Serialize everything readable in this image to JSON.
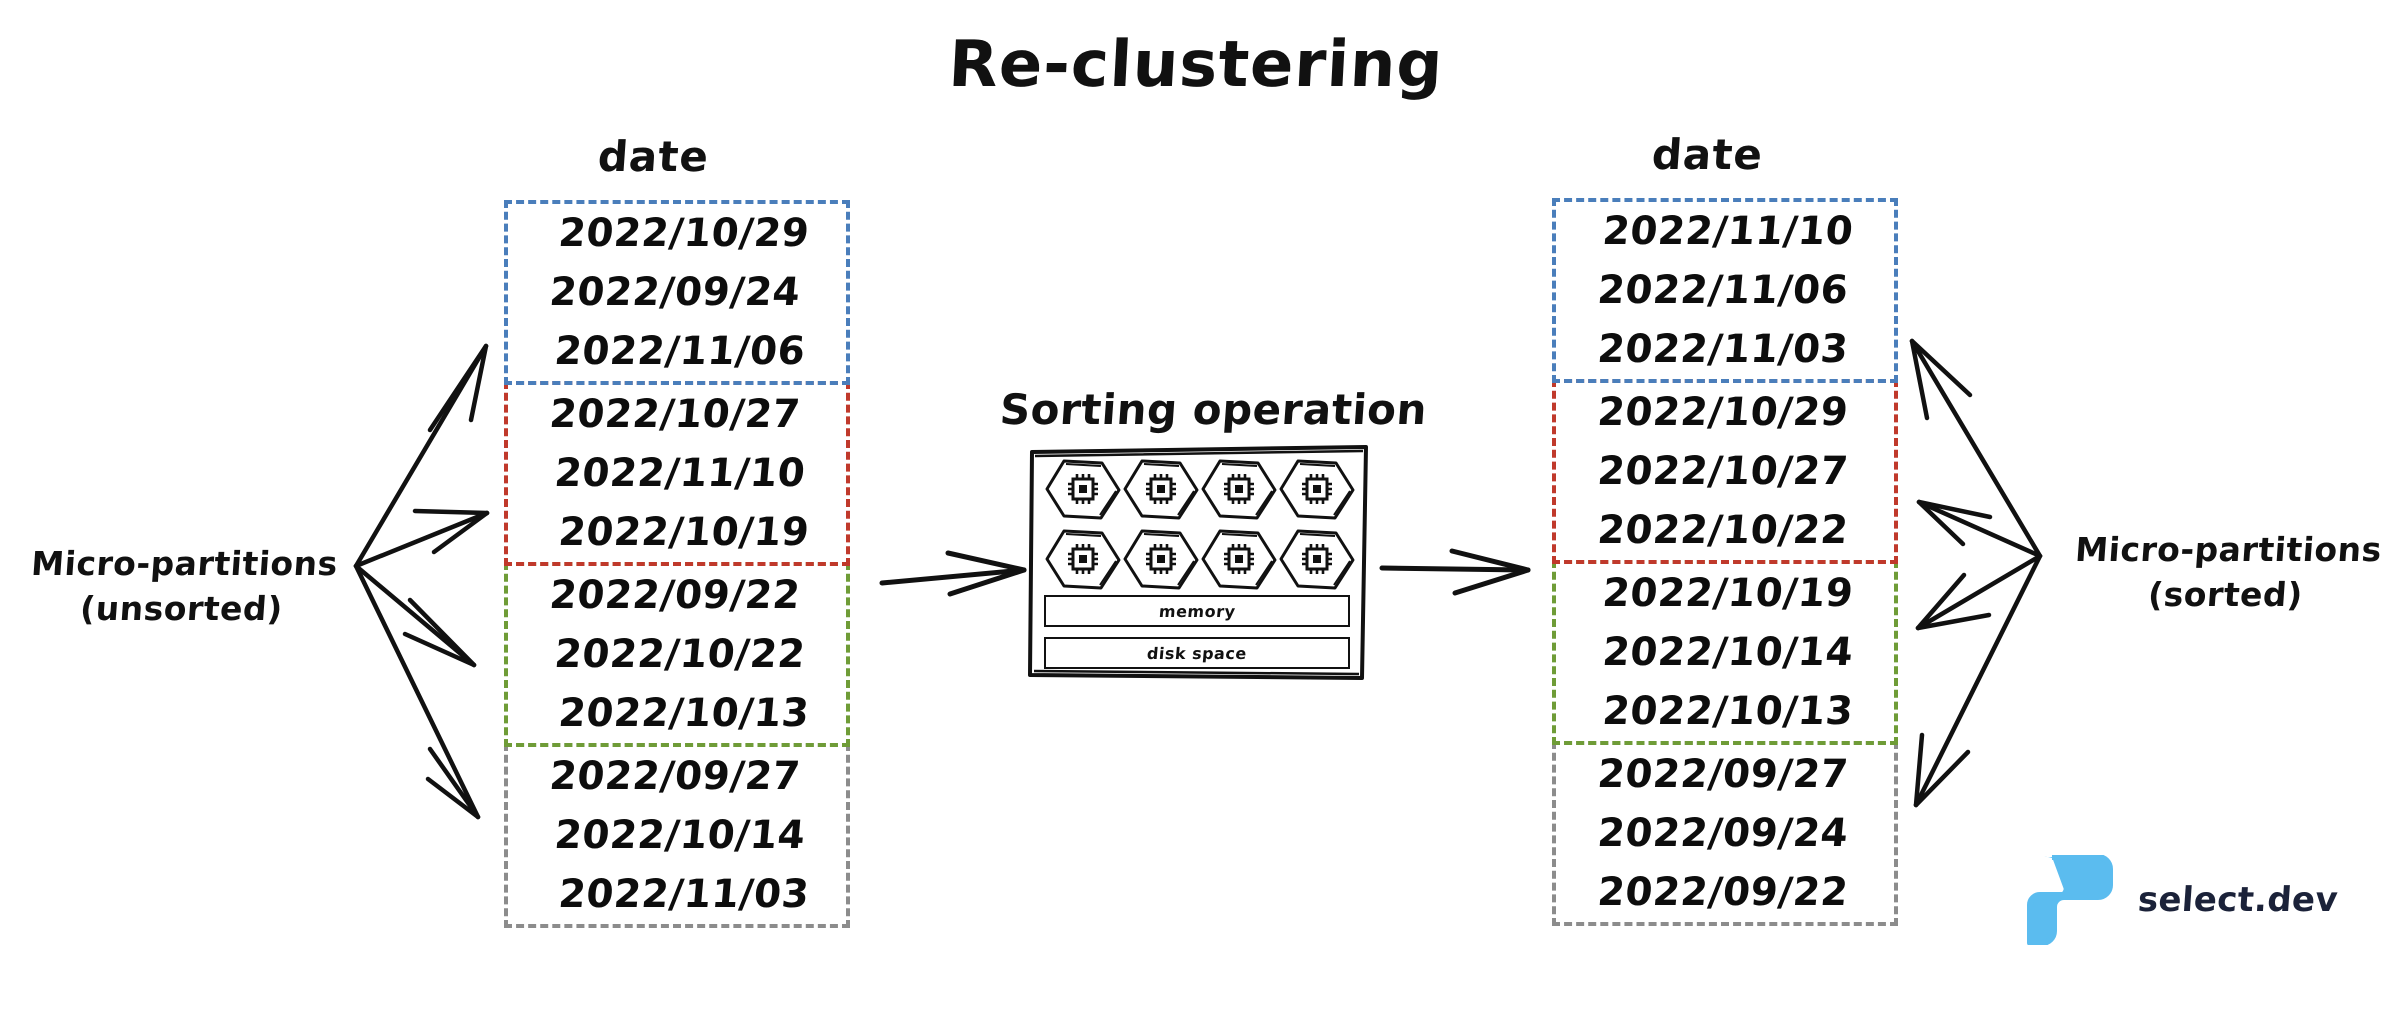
{
  "title": "Re-clustering",
  "colors": {
    "group_blue": "#4a7ebb",
    "group_red": "#c0392b",
    "group_green": "#6f9c37",
    "group_gray": "#8c8c8c",
    "ink": "#111111",
    "brand_blue": "#5bbcef",
    "brand_text": "#1b2239"
  },
  "left": {
    "column_header": "date",
    "side_label_line1": "Micro-partitions",
    "side_label_line2": "(unsorted)",
    "groups": [
      {
        "color": "blue",
        "rows": [
          "2022/10/29",
          "2022/09/24",
          "2022/11/06"
        ]
      },
      {
        "color": "red",
        "rows": [
          "2022/10/27",
          "2022/11/10",
          "2022/10/19"
        ]
      },
      {
        "color": "green",
        "rows": [
          "2022/09/22",
          "2022/10/22",
          "2022/10/13"
        ]
      },
      {
        "color": "gray",
        "rows": [
          "2022/09/27",
          "2022/10/14",
          "2022/11/03"
        ]
      }
    ]
  },
  "right": {
    "column_header": "date",
    "side_label_line1": "Micro-partitions",
    "side_label_line2": "(sorted)",
    "groups": [
      {
        "color": "blue",
        "rows": [
          "2022/11/10",
          "2022/11/06",
          "2022/11/03"
        ]
      },
      {
        "color": "red",
        "rows": [
          "2022/10/29",
          "2022/10/27",
          "2022/10/22"
        ]
      },
      {
        "color": "green",
        "rows": [
          "2022/10/19",
          "2022/10/14",
          "2022/10/13"
        ]
      },
      {
        "color": "gray",
        "rows": [
          "2022/09/27",
          "2022/09/24",
          "2022/09/22"
        ]
      }
    ]
  },
  "center": {
    "title": "Sorting operation",
    "memory_label": "memory",
    "disk_label": "disk space",
    "chip_count": 8,
    "chip_icon": "cpu-chip-icon"
  },
  "logo": {
    "text": "select.dev",
    "mark": "select-dev-logo-mark"
  }
}
